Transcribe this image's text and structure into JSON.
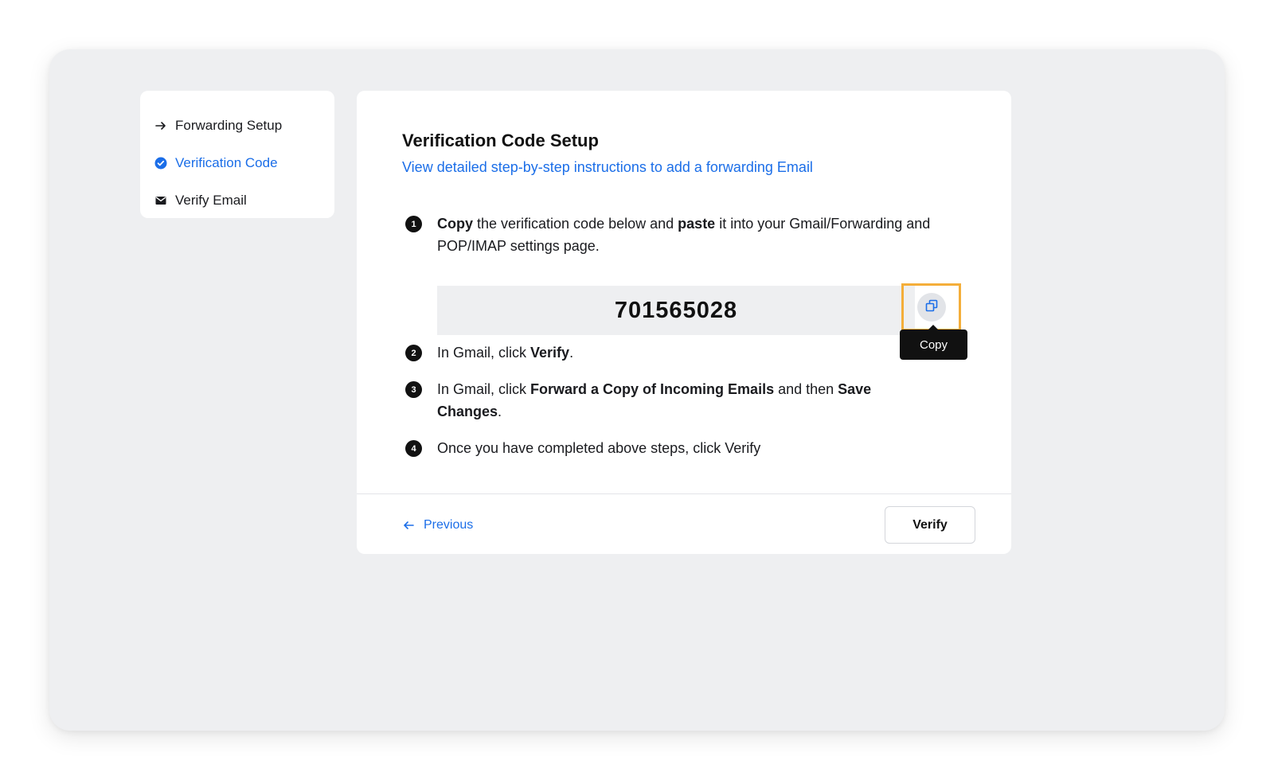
{
  "stepper": {
    "items": [
      {
        "label": "Forwarding Setup",
        "icon": "arrow-right-icon",
        "state": "done"
      },
      {
        "label": "Verification Code",
        "icon": "check-circle-icon",
        "state": "active"
      },
      {
        "label": "Verify Email",
        "icon": "envelope-icon",
        "state": "pending"
      }
    ]
  },
  "card": {
    "title": "Verification Code Setup",
    "link": "View detailed step-by-step instructions to add a forwarding Email",
    "steps": [
      {
        "number": "1",
        "parts": [
          "Copy",
          " the verification code below and ",
          "paste",
          " it into your Gmail/Forwarding and POP/IMAP settings page."
        ]
      },
      {
        "number": "2",
        "parts": [
          "In Gmail, click ",
          "Verify",
          "."
        ]
      },
      {
        "number": "3",
        "parts": [
          "In Gmail, click ",
          "Forward a Copy of Incoming Emails",
          " and then ",
          "Save Changes",
          "."
        ]
      },
      {
        "number": "4",
        "parts": [
          "Once you have completed above steps, click Verify"
        ]
      }
    ],
    "code": "701565028",
    "copy_tooltip": "Copy",
    "previous_label": "Previous",
    "verify_label": "Verify"
  },
  "colors": {
    "accent": "#1b6ee8",
    "highlight": "#f4ae3a",
    "background": "#eeeff1"
  }
}
